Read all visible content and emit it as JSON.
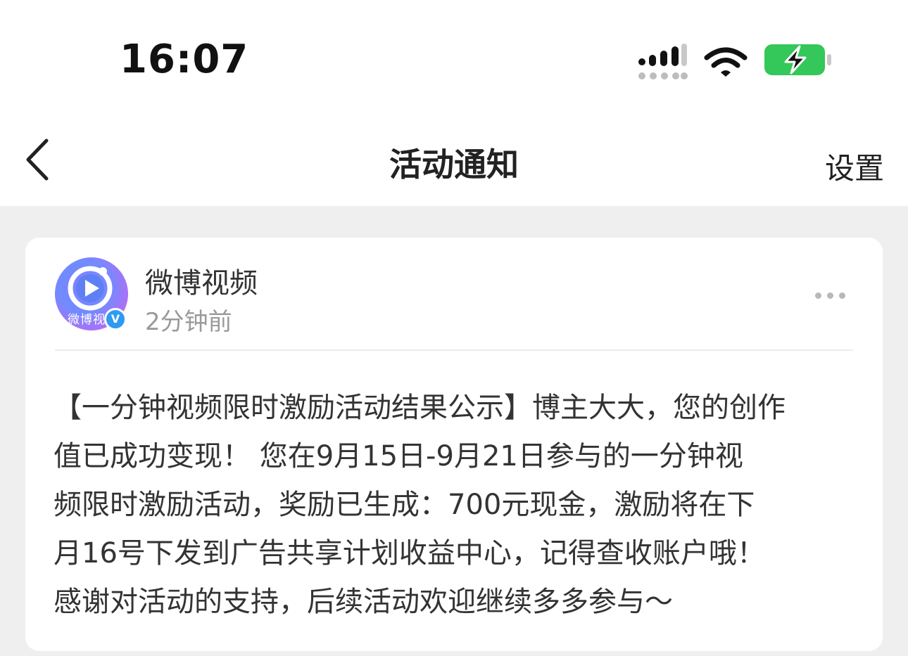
{
  "status_bar": {
    "time": "16:07",
    "icons": [
      "cellular-signal-icon",
      "wifi-icon",
      "battery-charging-icon"
    ],
    "battery_color": "#34c759"
  },
  "nav": {
    "back_icon": "chevron-left-icon",
    "title": "活动通知",
    "settings_label": "设置"
  },
  "notification": {
    "avatar_text": "微博视",
    "verified_mark": "V",
    "account_name": "微博视频",
    "time_ago": "2分钟前",
    "more_icon": "more-dots-icon",
    "message_lines": [
      "【一分钟视频限时激励活动结果公示】博主大大，您的创作",
      "值已成功变现！ 您在9月15日-9月21日参与的一分钟视",
      "频限时激励活动，奖励已生成：700元现金，激励将在下",
      "月16号下发到广告共享计划收益中心，记得查收账户哦！",
      "感谢对活动的支持，后续活动欢迎继续多多参与～"
    ]
  },
  "colors": {
    "page_background": "#efefef",
    "card_background": "#ffffff",
    "verified_blue": "#2f9af2"
  }
}
